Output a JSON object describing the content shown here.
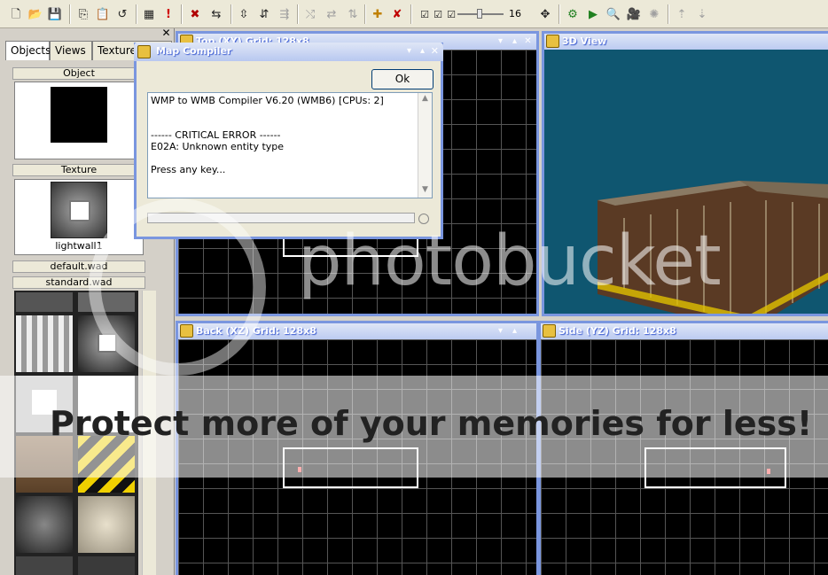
{
  "toolbar": {
    "icons": [
      "new-icon",
      "open-icon",
      "save-icon",
      "copy-icon",
      "paste-icon",
      "undo-icon",
      "properties-icon",
      "error-icon",
      "group-icon",
      "ungroup-icon",
      "hollow-icon",
      "split-icon",
      "move-icon",
      "scale-icon",
      "rotate-icon",
      "add-object-icon",
      "delete-object-icon",
      "grid-icon",
      "snap-icon",
      "vertex-icon",
      "zoom-slider",
      "compile-icon",
      "run-icon",
      "zoom-icon",
      "camera-icon",
      "light-icon",
      "scale-up-icon",
      "scale-down-icon"
    ],
    "grid_value": "16"
  },
  "left_panel": {
    "tabs": [
      {
        "label": "Objects"
      },
      {
        "label": "Views"
      },
      {
        "label": "Textures"
      }
    ],
    "object_header": "Object",
    "texture_header": "Texture",
    "texture_name": "lightwall1",
    "wads": [
      "default.wad",
      "standard.wad"
    ]
  },
  "windows": {
    "top": {
      "title": "Top (XY) Grid: 128x8"
    },
    "view3d": {
      "title": "3D View"
    },
    "back": {
      "title": "Back (XZ) Grid: 128x8"
    },
    "side": {
      "title": "Side (YZ) Grid: 128x8"
    }
  },
  "dialog": {
    "title": "Map Compiler",
    "ok_label": "Ok",
    "log_lines": [
      "WMP to WMB Compiler V6.20 (WMB6) [CPUs: 2]",
      "",
      "",
      "------ CRITICAL ERROR ------",
      "E02A: Unknown entity type",
      "",
      "Press any key..."
    ]
  },
  "watermark": {
    "brand": "photobucket",
    "banner": "Protect more of your memories for less!"
  }
}
